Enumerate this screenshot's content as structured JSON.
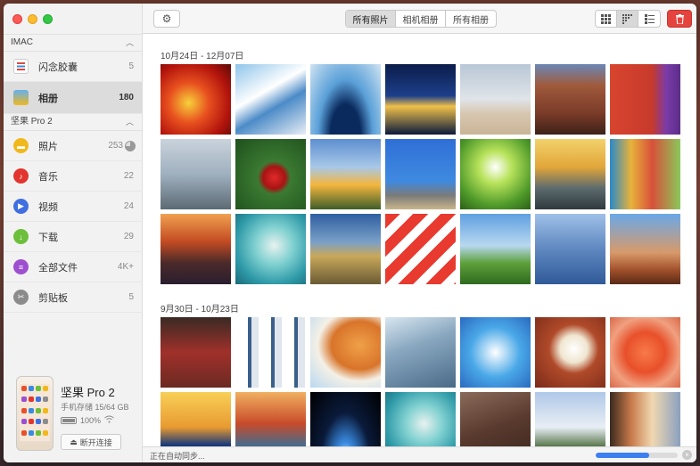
{
  "sidebar": {
    "sections": [
      {
        "title": "IMAC"
      },
      {
        "title": "坚果 Pro 2"
      }
    ],
    "items": [
      {
        "label": "闪念胶囊",
        "count": "5",
        "icon": "capsule-icon",
        "color": "#d84a3f"
      },
      {
        "label": "相册",
        "count": "180",
        "icon": "photos-icon",
        "color": "#3a8de0",
        "active": true
      },
      {
        "label": "照片",
        "count": "253",
        "icon": "photo-icon",
        "color": "#f1b81c"
      },
      {
        "label": "音乐",
        "count": "22",
        "icon": "music-icon",
        "color": "#e3352f"
      },
      {
        "label": "视频",
        "count": "24",
        "icon": "video-icon",
        "color": "#3f6fe0"
      },
      {
        "label": "下载",
        "count": "29",
        "icon": "download-icon",
        "color": "#6cbf3a"
      },
      {
        "label": "全部文件",
        "count": "4K+",
        "icon": "files-icon",
        "color": "#9d4fd0"
      },
      {
        "label": "剪贴板",
        "count": "5",
        "icon": "clipboard-icon",
        "color": "#8c8c8c"
      }
    ],
    "device": {
      "name": "坚果 Pro 2",
      "storage": "手机存储 15/64 GB",
      "battery": "100%",
      "disconnect_label": "断开连接"
    }
  },
  "toolbar": {
    "tabs": [
      "所有照片",
      "相机相册",
      "所有相册"
    ],
    "active_tab": "所有照片",
    "views": [
      "large-grid-icon",
      "small-grid-icon",
      "list-icon"
    ]
  },
  "sections": [
    {
      "date_range": "10月24日 - 12月07日",
      "photo_count": 21
    },
    {
      "date_range": "9月30日 - 10月23日",
      "photo_count": 14
    }
  ],
  "status": {
    "text": "正在自动同步...",
    "progress": 0.65,
    "accent_color": "#3b7ff0"
  }
}
